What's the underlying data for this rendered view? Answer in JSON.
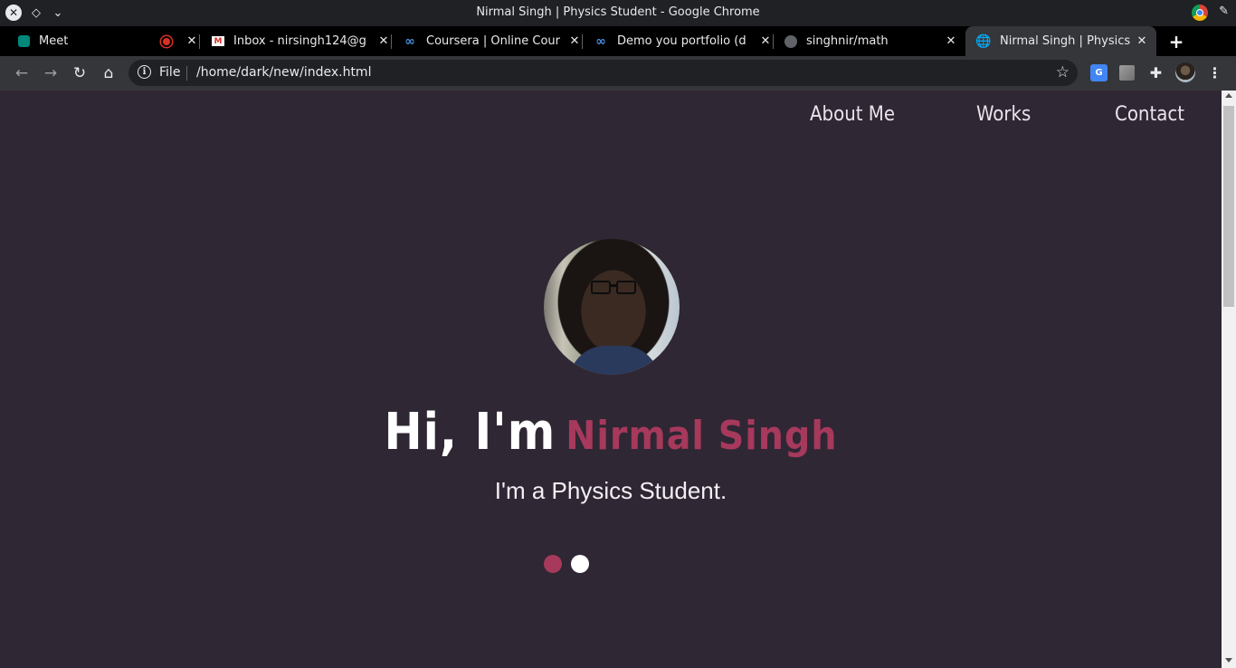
{
  "window": {
    "title": "Nirmal Singh | Physics Student - Google Chrome"
  },
  "tabs": [
    {
      "label": "Meet",
      "favicon": "meet-icon"
    },
    {
      "label": "Inbox - nirsingh124@g",
      "favicon": "gmail-icon"
    },
    {
      "label": "Coursera | Online Cour",
      "favicon": "coursera-icon"
    },
    {
      "label": "Demo you portfolio (d",
      "favicon": "coursera-icon"
    },
    {
      "label": "singhnir/math",
      "favicon": "github-icon"
    },
    {
      "label": "Nirmal Singh | Physics",
      "favicon": "globe-icon",
      "active": true
    }
  ],
  "omnibox": {
    "scheme_label": "File",
    "url": "/home/dark/new/index.html"
  },
  "nav": {
    "about": "About Me",
    "works": "Works",
    "contact": "Contact"
  },
  "hero": {
    "greeting": "Hi, I'm",
    "name": "Nirmal Singh",
    "subtitle": "I'm a Physics Student.",
    "accent_color": "#a6395c",
    "background_color": "#2f2733"
  }
}
